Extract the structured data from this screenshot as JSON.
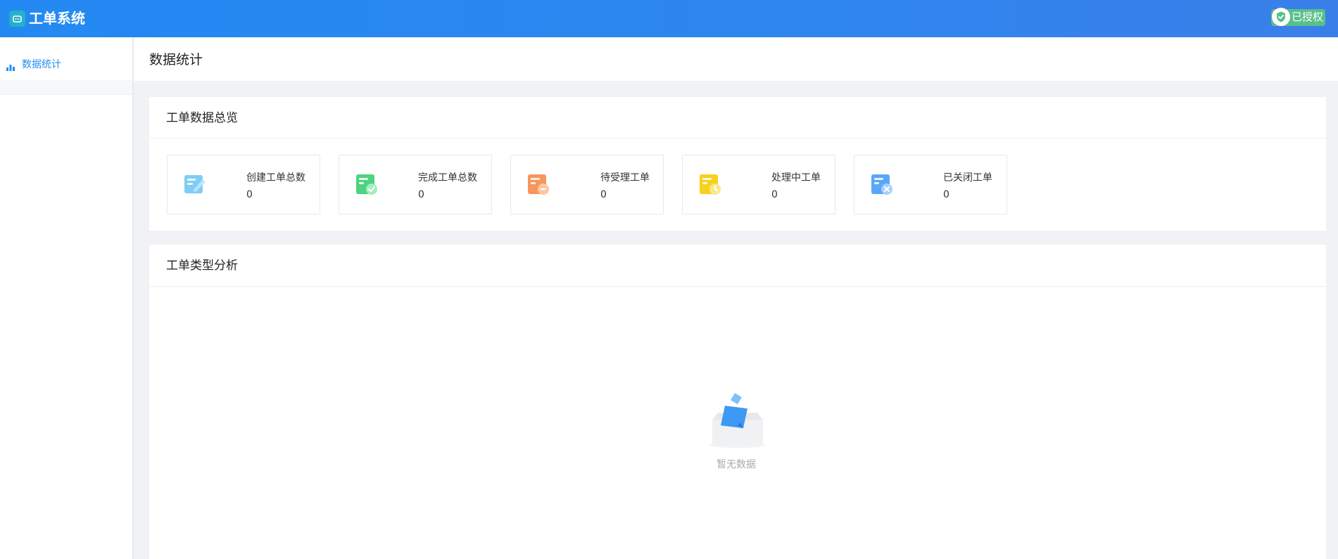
{
  "header": {
    "app_title": "工单系统",
    "auth_label": "已授权",
    "logo_icon": "headset-icon"
  },
  "sidebar": {
    "items": [
      {
        "label": "数据统计",
        "icon": "bar-chart-icon",
        "active": true
      }
    ]
  },
  "page": {
    "title": "数据统计"
  },
  "overview": {
    "title": "工单数据总览",
    "cards": [
      {
        "label": "创建工单总数",
        "value": "0",
        "icon": "create-ticket-icon",
        "color": "#5ab8f5"
      },
      {
        "label": "完成工单总数",
        "value": "0",
        "icon": "completed-ticket-icon",
        "color": "#4cd37e"
      },
      {
        "label": "待受理工单",
        "value": "0",
        "icon": "pending-ticket-icon",
        "color": "#f8955a"
      },
      {
        "label": "处理中工单",
        "value": "0",
        "icon": "processing-ticket-icon",
        "color": "#f5d21e"
      },
      {
        "label": "已关闭工单",
        "value": "0",
        "icon": "closed-ticket-icon",
        "color": "#5aa6f8"
      }
    ]
  },
  "analysis": {
    "title": "工单类型分析",
    "empty_text": "暂无数据",
    "empty_icon": "empty-box-icon"
  },
  "colors": {
    "header_gradient_start": "#2389f2",
    "header_gradient_end": "#3a7fe9",
    "accent": "#1f8ff2",
    "auth_badge": "#57c08a",
    "background": "#f0f2f5"
  }
}
